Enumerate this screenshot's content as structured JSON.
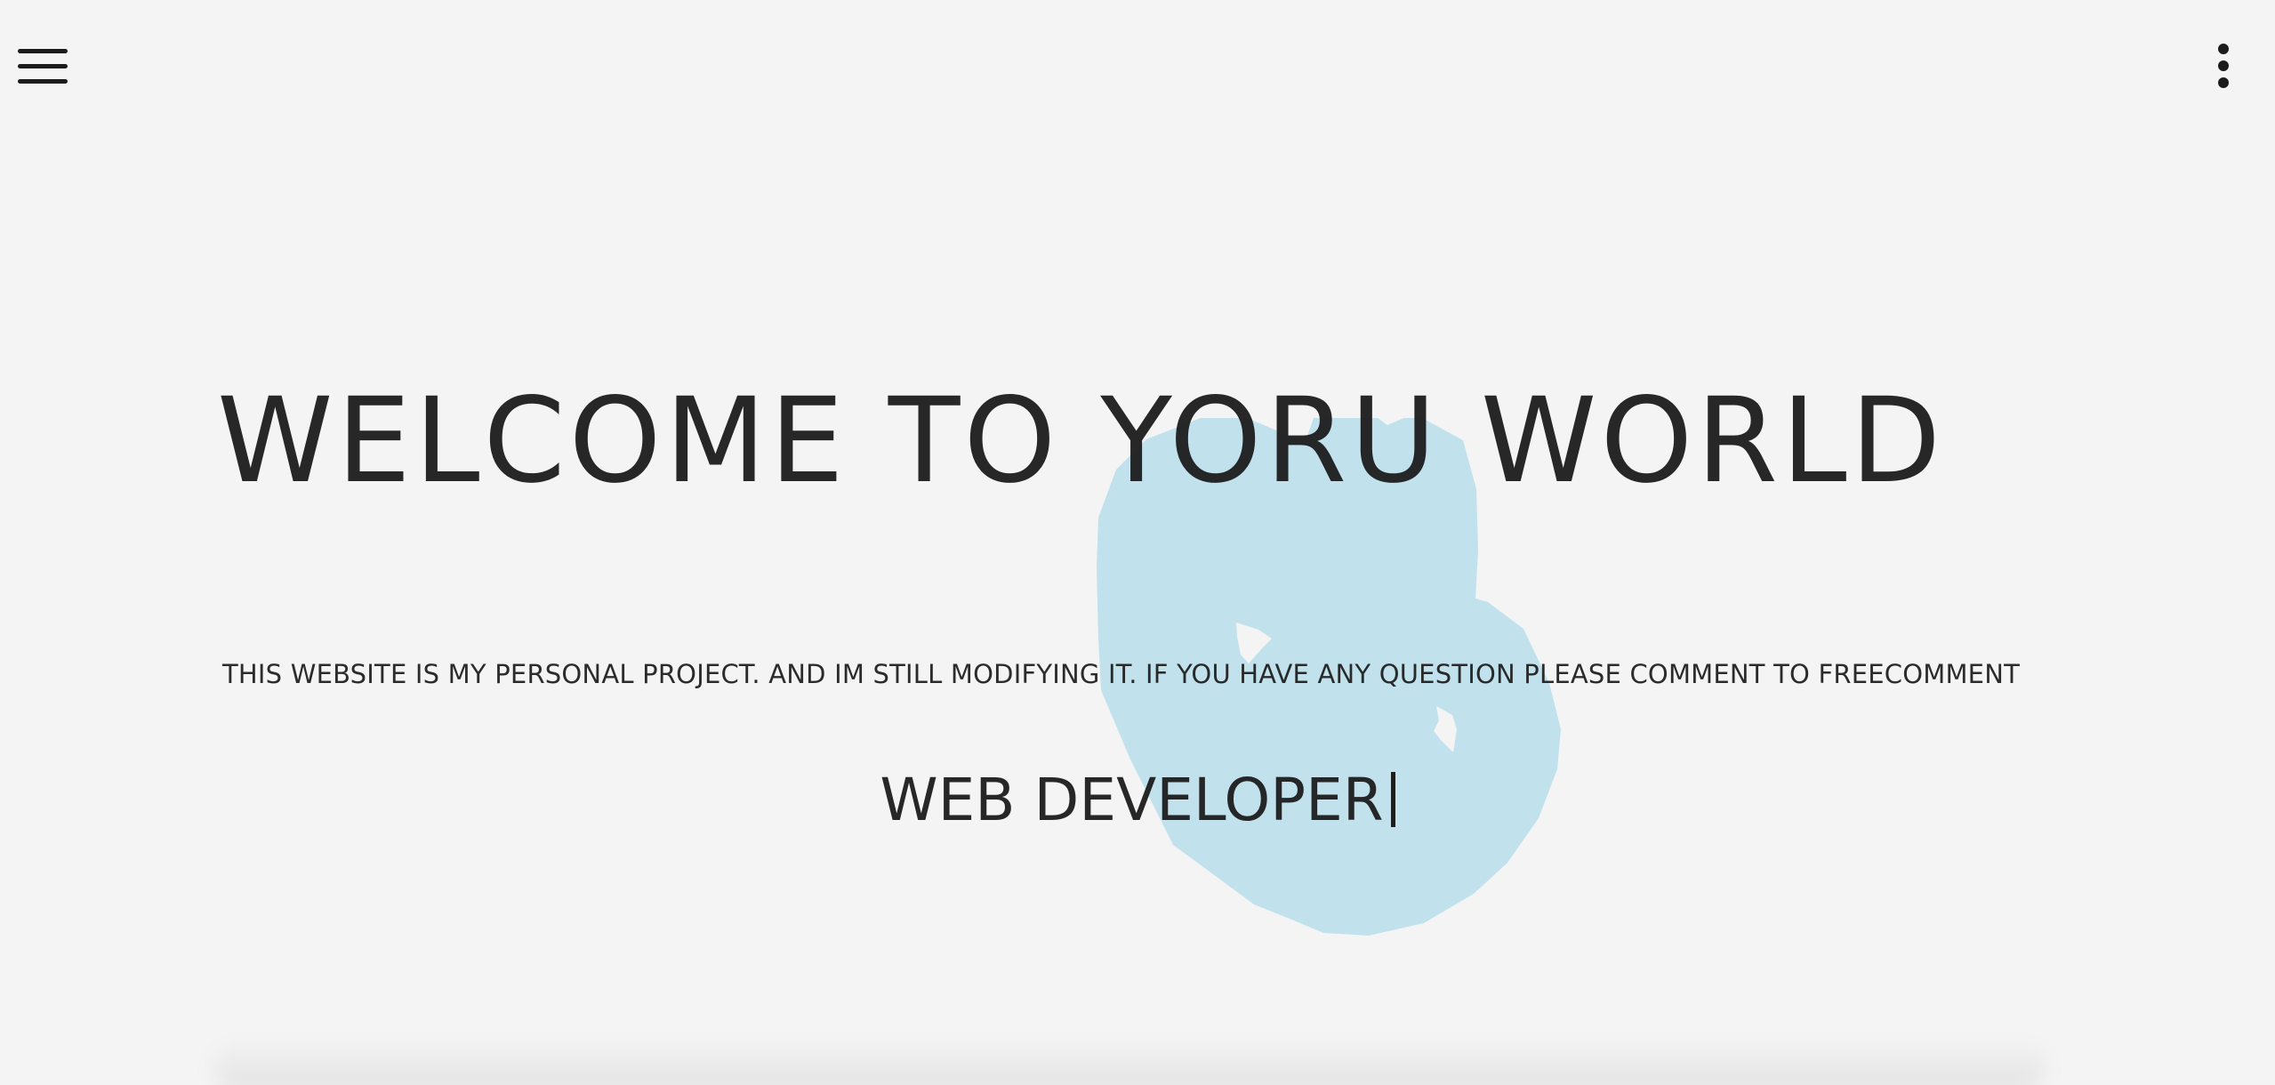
{
  "header": {
    "menu_icon": "hamburger-menu-icon",
    "more_icon": "more-vertical-icon"
  },
  "hero": {
    "title": "WELCOME TO YORU WORLD",
    "description": "THIS WEBSITE IS MY PERSONAL PROJECT. AND IM STILL MODIFYING IT. IF YOU HAVE ANY QUESTION PLEASE COMMENT TO FREECOMMENT",
    "role": "WEB DEVELOPER"
  },
  "colors": {
    "background": "#f4f4f4",
    "text": "#222222",
    "blob": "#c1e2ed"
  }
}
